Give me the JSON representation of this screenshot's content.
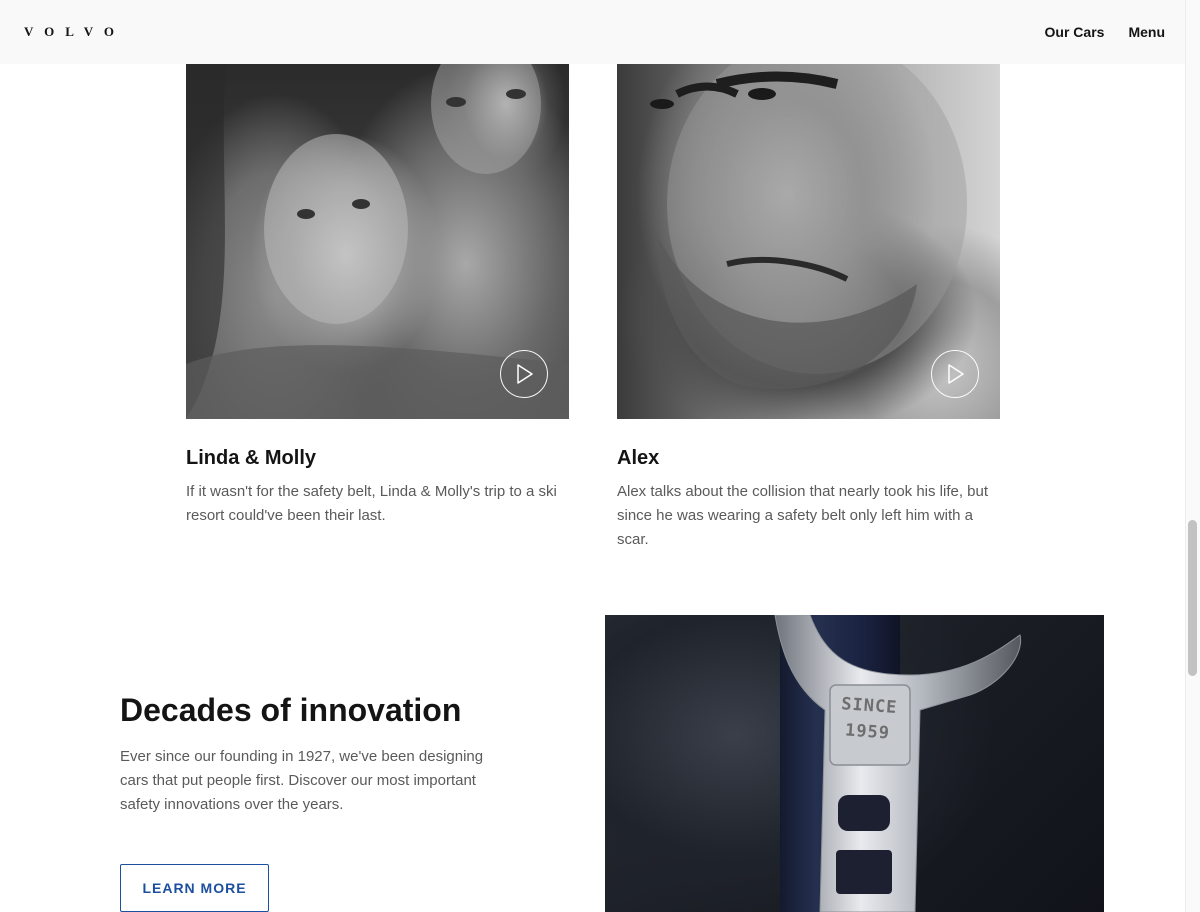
{
  "header": {
    "logo": "VOLVO",
    "nav": [
      "Our Cars",
      "Menu"
    ]
  },
  "stories": [
    {
      "title": "Linda & Molly",
      "description": "If it wasn't for the safety belt, Linda & Molly's trip to a ski resort could've been their last."
    },
    {
      "title": "Alex",
      "description": "Alex talks about the collision that nearly took his life, but since he was wearing a safety belt only left him with a scar."
    }
  ],
  "innovation": {
    "title": "Decades of innovation",
    "description": "Ever since our founding in 1927, we've been designing cars that put people first. Discover our most important safety innovations over the years.",
    "button_label": "LEARN MORE",
    "image_stamp": [
      "SINCE",
      "1959"
    ]
  },
  "colors": {
    "accent": "#1c4fa0",
    "text": "#141414",
    "muted_text": "#5a5a5a",
    "header_bg": "#f9f9f9"
  },
  "icons": [
    "play-icon",
    "play-icon"
  ]
}
